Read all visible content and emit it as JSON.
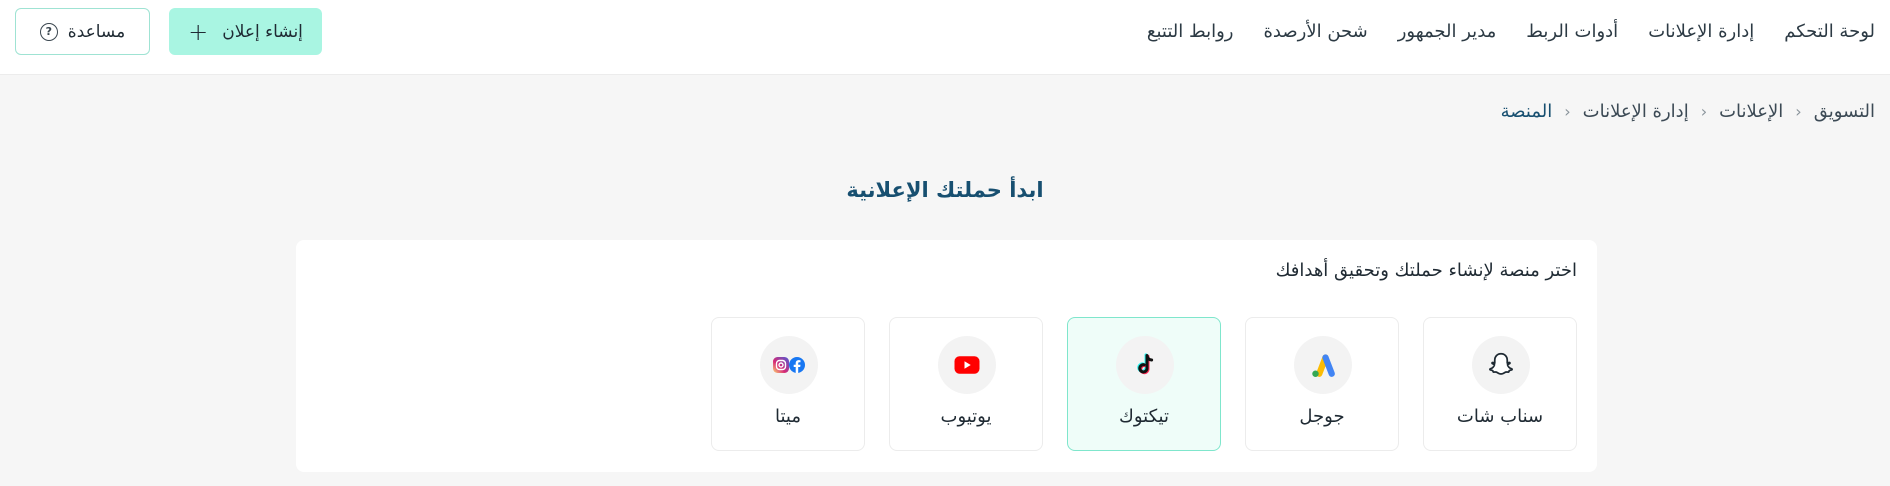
{
  "nav": {
    "items": [
      "لوحة التحكم",
      "إدارة الإعلانات",
      "أدوات الربط",
      "مدير الجمهور",
      "شحن الأرصدة",
      "روابط التتبع"
    ]
  },
  "header_actions": {
    "create_ad_label": "إنشاء إعلان",
    "help_label": "مساعدة",
    "help_icon_glyph": "?"
  },
  "breadcrumb": {
    "items": [
      "التسويق",
      "الإعلانات",
      "إدارة الإعلانات",
      "المنصة"
    ],
    "separator": "‹"
  },
  "main": {
    "title": "ابدأ حملتك الإعلانية",
    "subtitle": "اختر منصة لإنشاء حملتك وتحقيق أهدافك",
    "platforms": [
      {
        "label": "سناب شات",
        "icon": "snapchat-icon"
      },
      {
        "label": "جوجل",
        "icon": "google-ads-icon"
      },
      {
        "label": "تيكتوك",
        "icon": "tiktok-icon",
        "selected": true
      },
      {
        "label": "يوتيوب",
        "icon": "youtube-icon"
      },
      {
        "label": "ميتا",
        "icon": "meta-icon"
      }
    ]
  },
  "colors": {
    "accent": "#a9f5e2",
    "accent_border": "#7fe6cc",
    "title": "#174f70",
    "background": "#f6f6f6",
    "youtube": "#ff0000",
    "facebook": "#1877f2"
  }
}
